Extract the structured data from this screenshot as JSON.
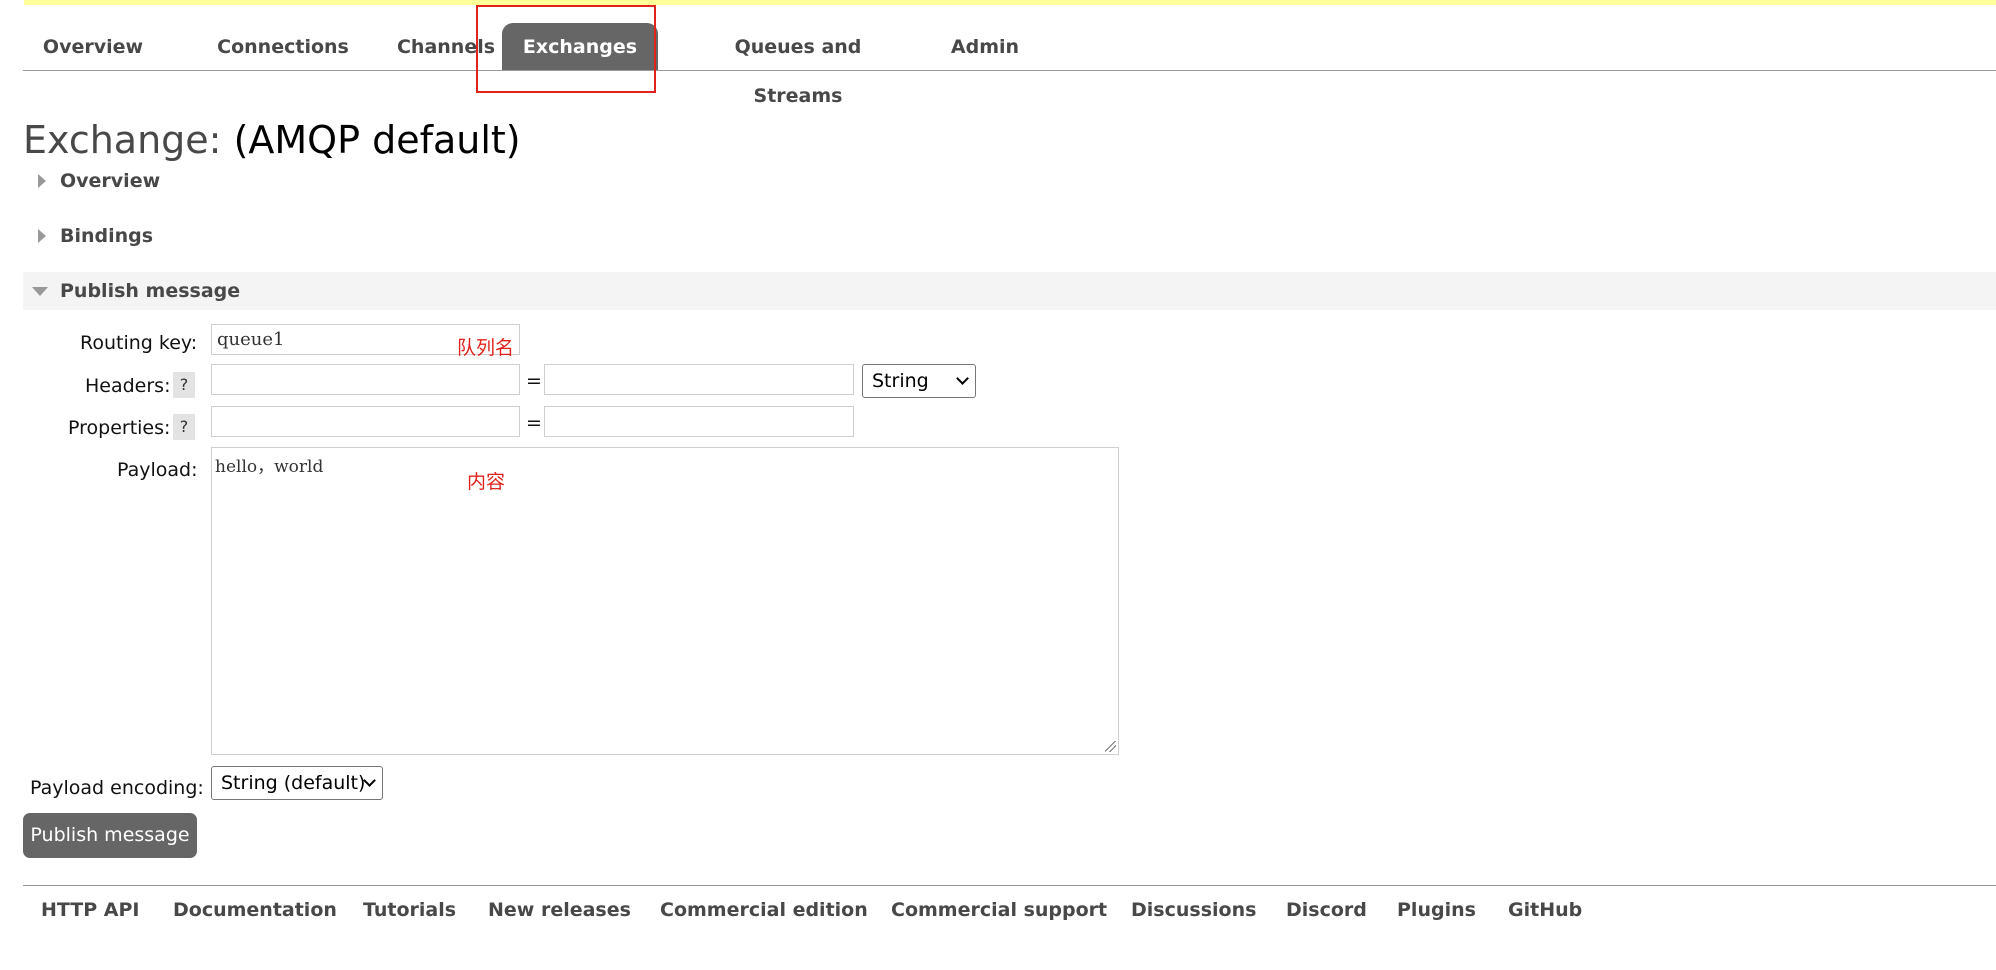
{
  "nav": {
    "tabs": [
      {
        "label": "Overview"
      },
      {
        "label": "Connections"
      },
      {
        "label": "Channels"
      },
      {
        "label": "Exchanges"
      },
      {
        "label": "Queues and Streams"
      },
      {
        "label": "Admin"
      }
    ],
    "active_tab": "Exchanges",
    "highlight_color": "#e0241b"
  },
  "page": {
    "title_prefix": "Exchange:",
    "title_name": "(AMQP default)"
  },
  "sections": {
    "overview": "Overview",
    "bindings": "Bindings",
    "publish": "Publish message"
  },
  "form": {
    "routing_key_label": "Routing key:",
    "routing_key_value": "queue1",
    "routing_key_note": "队列名",
    "headers_label": "Headers:",
    "help": "?",
    "equals": "=",
    "header_type": "String",
    "properties_label": "Properties:",
    "payload_label": "Payload:",
    "payload_value": "hello，world",
    "payload_note": "内容",
    "encoding_label": "Payload encoding:",
    "encoding_value": "String (default)",
    "submit": "Publish message"
  },
  "footer": {
    "links": [
      "HTTP API",
      "Documentation",
      "Tutorials",
      "New releases",
      "Commercial edition",
      "Commercial support",
      "Discussions",
      "Discord",
      "Plugins",
      "GitHub"
    ]
  },
  "colors": {
    "tab_active_bg": "#666666",
    "annotation_red": "#e0241b",
    "top_bar": "#ffff99"
  }
}
